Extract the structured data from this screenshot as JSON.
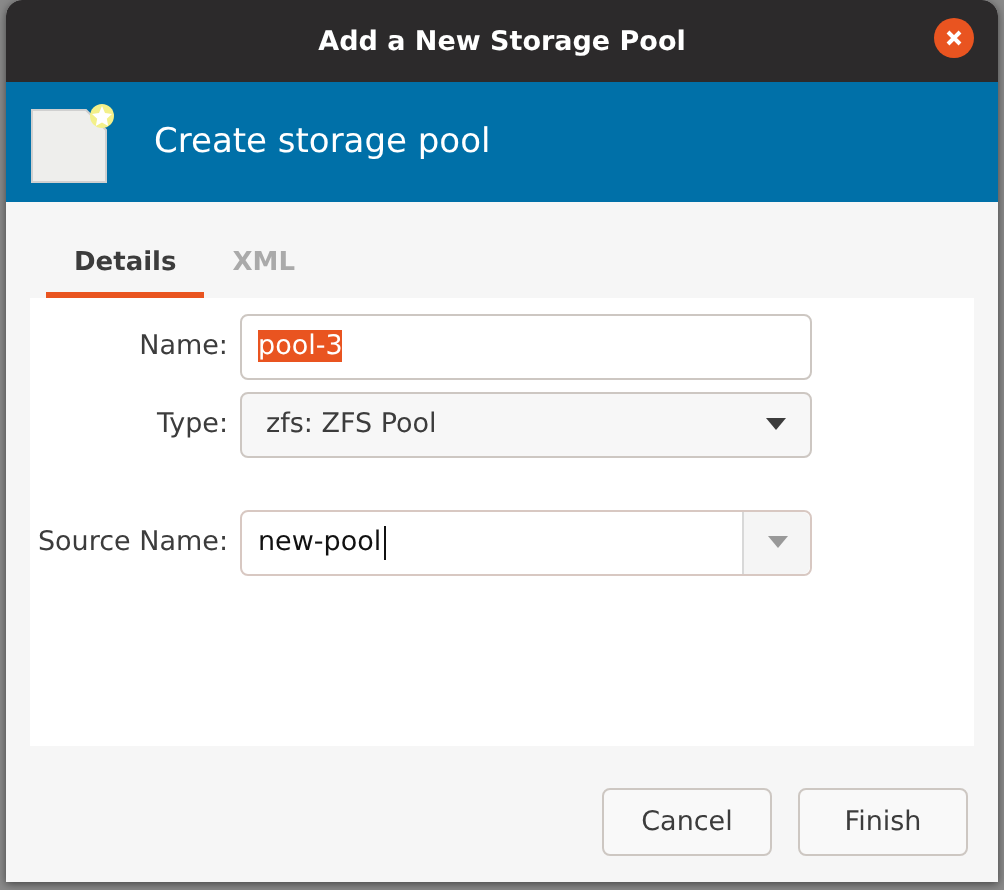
{
  "window": {
    "title": "Add a New Storage Pool"
  },
  "banner": {
    "title": "Create storage pool"
  },
  "tabs": [
    {
      "label": "Details",
      "selected": true
    },
    {
      "label": "XML",
      "selected": false
    }
  ],
  "fields": [
    {
      "kind": "text",
      "label": "Name:",
      "value": "pool-3",
      "text_selected": true
    },
    {
      "kind": "combo",
      "label": "Type:",
      "value": "zfs: ZFS Pool"
    },
    {
      "kind": "entry-combo",
      "label": "Source Name:",
      "value": "new-pool",
      "caret": true
    }
  ],
  "buttons": [
    "Cancel",
    "Finish"
  ]
}
